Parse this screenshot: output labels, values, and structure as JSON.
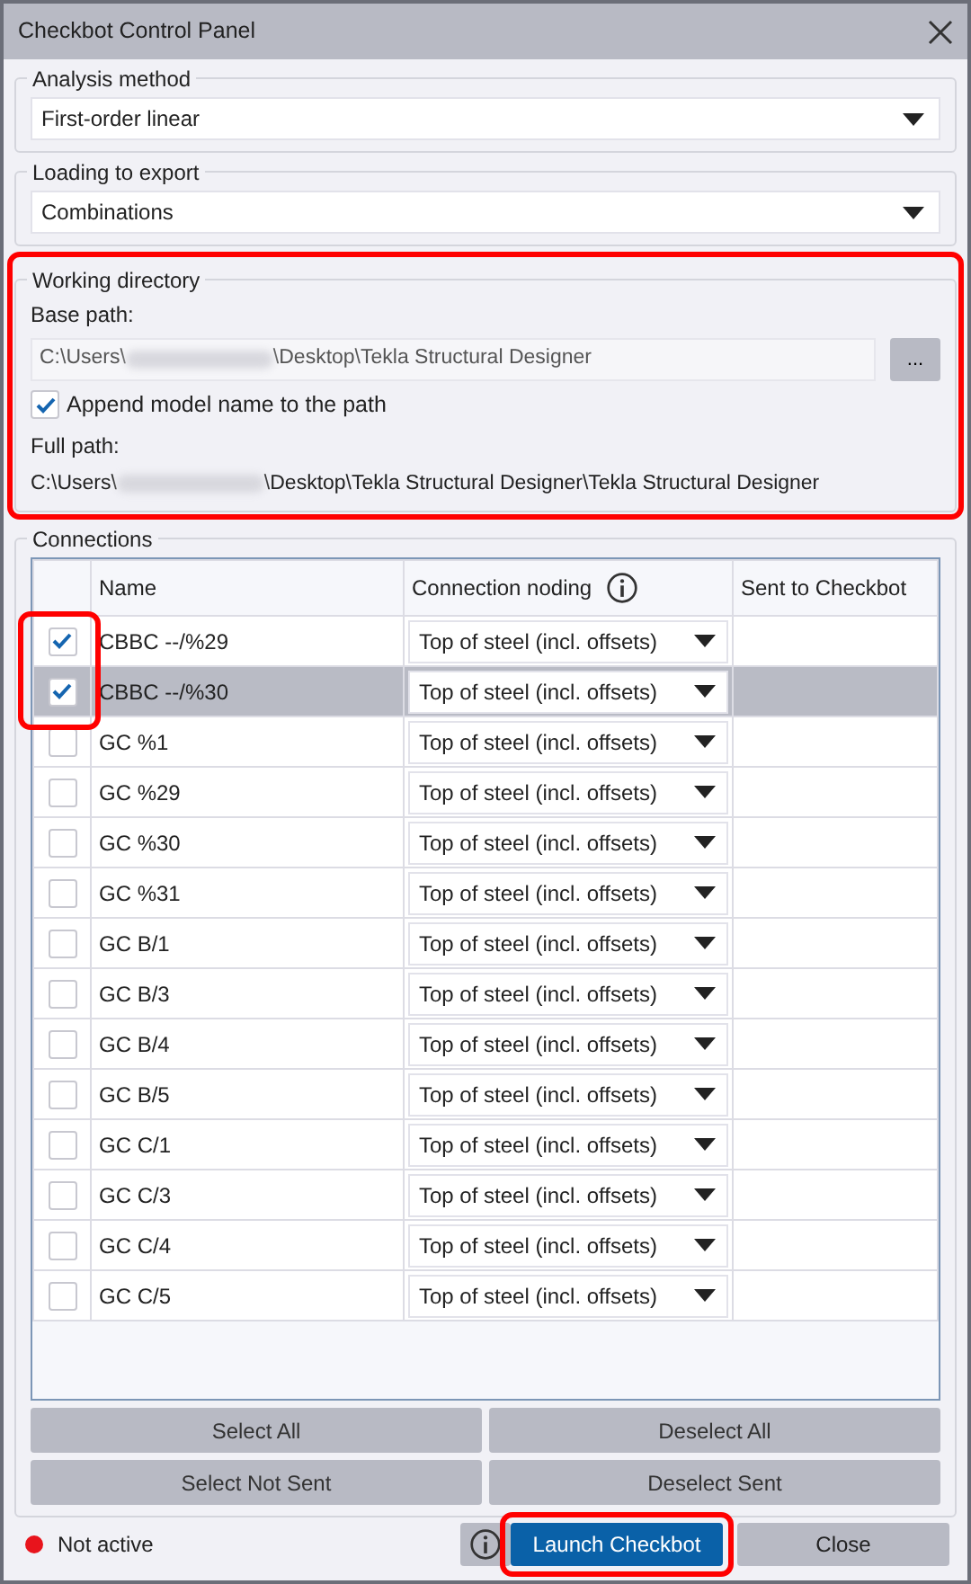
{
  "window": {
    "title": "Checkbot Control Panel"
  },
  "analysis_method": {
    "label": "Analysis method",
    "value": "First-order linear"
  },
  "loading_to_export": {
    "label": "Loading to export",
    "value": "Combinations"
  },
  "working_directory": {
    "label": "Working directory",
    "highlighted": true,
    "base_path_label": "Base path:",
    "base_path": {
      "prefix": "C:\\Users\\",
      "suffix": "\\Desktop\\Tekla Structural Designer"
    },
    "browse_button": "...",
    "append": {
      "label": "Append model name to the path",
      "checked": true
    },
    "full_path_label": "Full path:",
    "full_path": {
      "prefix": "C:\\Users\\",
      "suffix": "\\Desktop\\Tekla Structural Designer\\Tekla Structural Designer"
    }
  },
  "connections": {
    "label": "Connections",
    "checkbox_column_highlighted": true,
    "columns": [
      "Name",
      "Connection noding",
      "Sent to Checkbot"
    ],
    "rows": [
      {
        "name": "CBBC --/%29",
        "noding": "Top of steel (incl. offsets)",
        "checked": true,
        "selected": false
      },
      {
        "name": "CBBC --/%30",
        "noding": "Top of steel (incl. offsets)",
        "checked": true,
        "selected": true
      },
      {
        "name": "GC %1",
        "noding": "Top of steel (incl. offsets)",
        "checked": false,
        "selected": false
      },
      {
        "name": "GC %29",
        "noding": "Top of steel (incl. offsets)",
        "checked": false,
        "selected": false
      },
      {
        "name": "GC %30",
        "noding": "Top of steel (incl. offsets)",
        "checked": false,
        "selected": false
      },
      {
        "name": "GC %31",
        "noding": "Top of steel (incl. offsets)",
        "checked": false,
        "selected": false
      },
      {
        "name": "GC B/1",
        "noding": "Top of steel (incl. offsets)",
        "checked": false,
        "selected": false
      },
      {
        "name": "GC B/3",
        "noding": "Top of steel (incl. offsets)",
        "checked": false,
        "selected": false
      },
      {
        "name": "GC B/4",
        "noding": "Top of steel (incl. offsets)",
        "checked": false,
        "selected": false
      },
      {
        "name": "GC B/5",
        "noding": "Top of steel (incl. offsets)",
        "checked": false,
        "selected": false
      },
      {
        "name": "GC C/1",
        "noding": "Top of steel (incl. offsets)",
        "checked": false,
        "selected": false
      },
      {
        "name": "GC C/3",
        "noding": "Top of steel (incl. offsets)",
        "checked": false,
        "selected": false
      },
      {
        "name": "GC C/4",
        "noding": "Top of steel (incl. offsets)",
        "checked": false,
        "selected": false
      },
      {
        "name": "GC C/5",
        "noding": "Top of steel (incl. offsets)",
        "checked": false,
        "selected": false
      }
    ],
    "buttons": [
      "Select All",
      "Deselect All",
      "Select Not Sent",
      "Deselect Sent"
    ]
  },
  "status": {
    "text": "Not active",
    "color": "#e8141c"
  },
  "footer_buttons": [
    {
      "label": "Launch Checkbot",
      "kind": "primary",
      "highlighted": true
    },
    {
      "label": "Close",
      "kind": "secondary",
      "highlighted": false
    }
  ]
}
